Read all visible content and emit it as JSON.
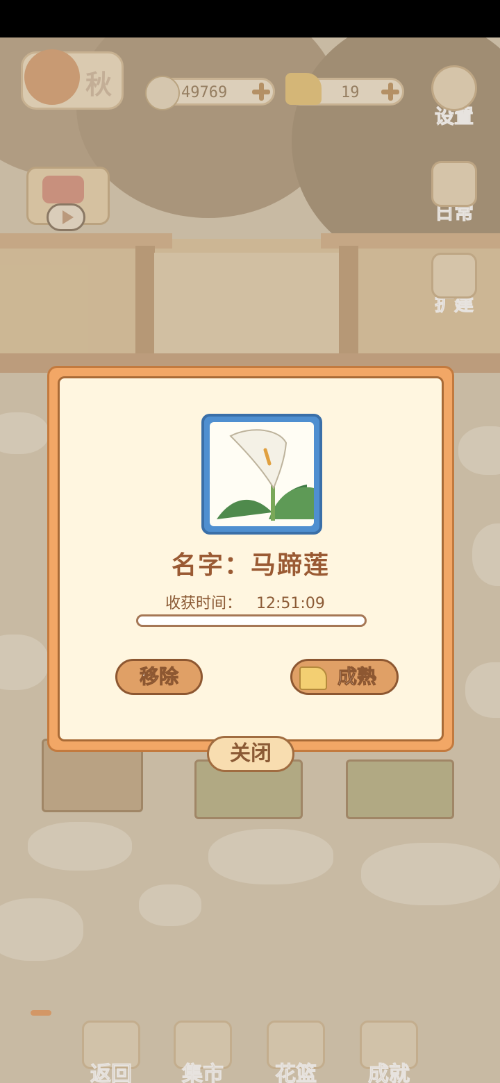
{
  "hud": {
    "season": "秋",
    "fish_count": "49769",
    "cheese_count": "19"
  },
  "side_buttons": {
    "settings": "设置",
    "daily": "日常",
    "expand": "扩建"
  },
  "dialog": {
    "name_label": "名字：马蹄莲",
    "harvest_label": "收获时间：",
    "harvest_time": "12:51:09",
    "progress": 0,
    "remove_button": "移除",
    "ripen_button": "成熟",
    "close_button": "关闭"
  },
  "bottom_nav": {
    "back": "返回",
    "market": "集市",
    "basket": "花篮",
    "achievements": "成就"
  },
  "colors": {
    "accent": "#f2a766",
    "dialog_bg": "#fff6e0",
    "text_brown": "#9a5a33",
    "plant_frame": "#4f8fd0"
  }
}
